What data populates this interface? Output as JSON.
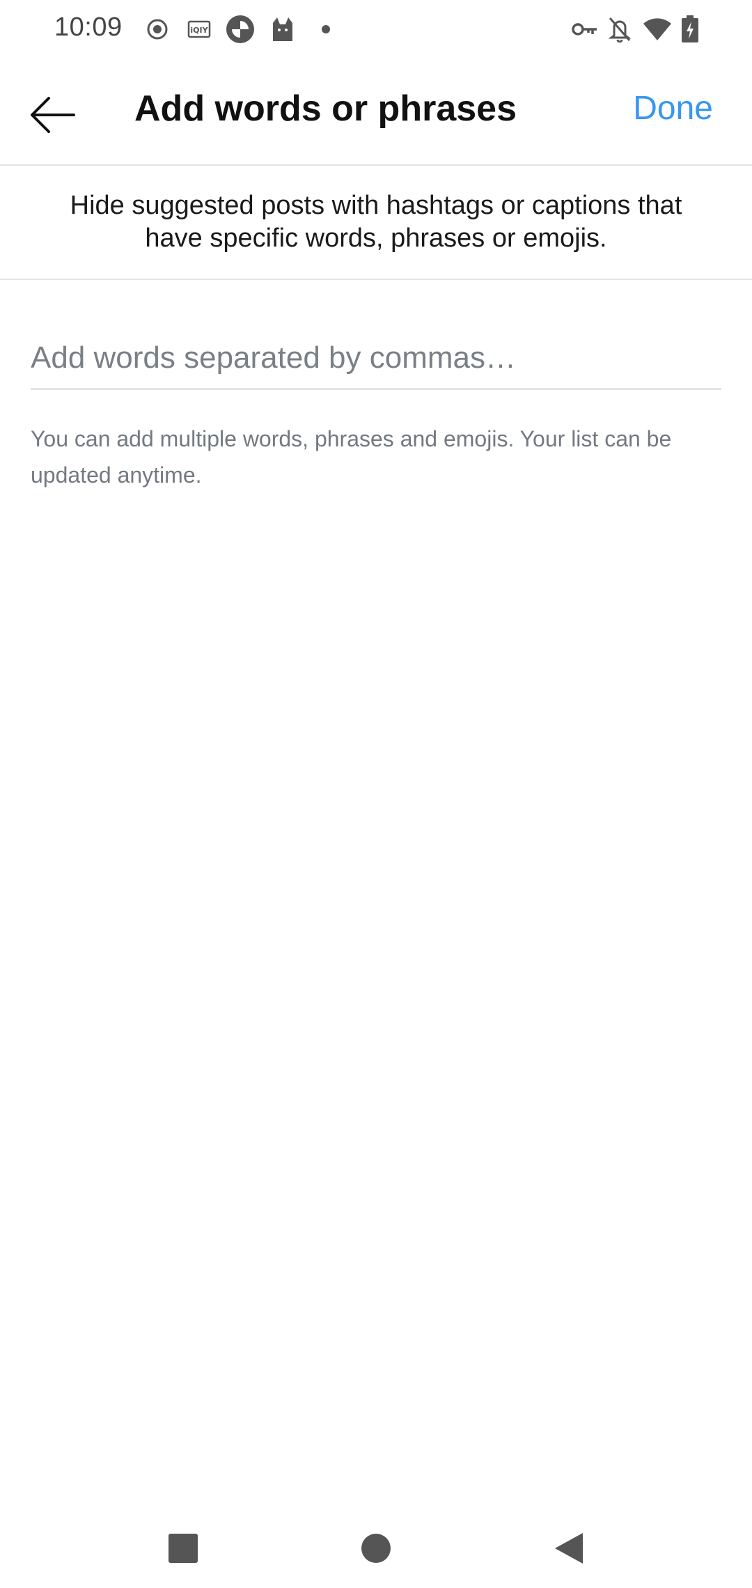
{
  "status_bar": {
    "time": "10:09",
    "left_icons": [
      "record-icon",
      "iqiyi-icon",
      "camera-app-icon",
      "cat-icon",
      "dot-icon"
    ],
    "right_icons": [
      "key-icon",
      "notifications-off-icon",
      "wifi-icon",
      "battery-charging-icon"
    ]
  },
  "header": {
    "title": "Add words or phrases",
    "back_icon": "arrow-left-icon",
    "done_label": "Done"
  },
  "description": {
    "text": "Hide suggested posts with hashtags or captions that have specific words, phrases or emojis."
  },
  "input": {
    "value": "",
    "placeholder": "Add words separated by commas…"
  },
  "helper": {
    "text": "You can add multiple words, phrases and emojis. Your list can be updated anytime."
  },
  "nav_bar": {
    "buttons": [
      "recents-square-icon",
      "home-circle-icon",
      "back-triangle-icon"
    ]
  },
  "colors": {
    "accent": "#3897f0",
    "divider": "#e3e3e3",
    "secondary_text": "#737980",
    "nav_icon": "#555555"
  }
}
